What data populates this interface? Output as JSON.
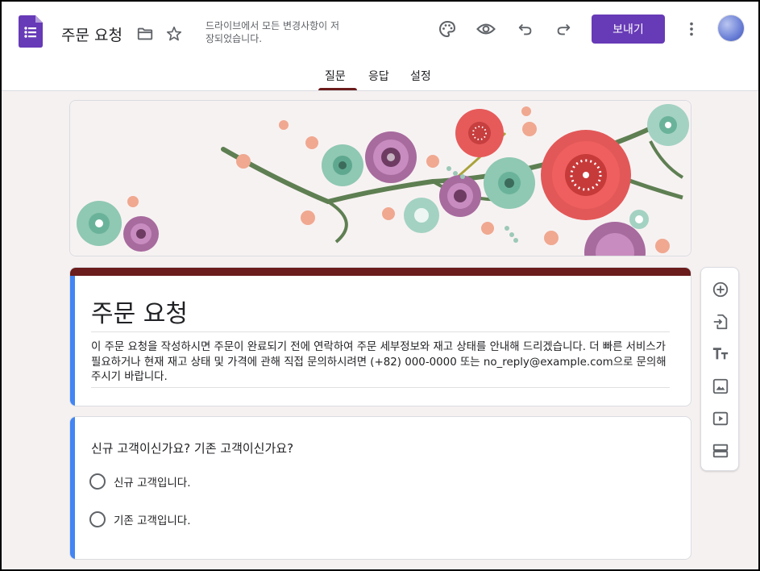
{
  "header": {
    "doc_title": "주문 요청",
    "save_status": "드라이브에서 모든 변경사항이 저장되었습니다.",
    "send_label": "보내기",
    "brand_color": "#673ab7",
    "icons": [
      "forms-logo-icon",
      "folder-icon",
      "star-icon",
      "palette-icon",
      "preview-eye-icon",
      "undo-icon",
      "redo-icon",
      "more-vert-icon"
    ]
  },
  "tabs": [
    {
      "label": "질문",
      "active": true
    },
    {
      "label": "응답",
      "active": false
    },
    {
      "label": "설정",
      "active": false
    }
  ],
  "form": {
    "title": "주문 요청",
    "description": "이 주문 요청을 작성하시면 주문이 완료되기 전에 연락하여 주문 세부정보와 재고 상태를 안내해 드리겠습니다. 더 빠른 서비스가 필요하거나 현재 재고 상태 및 가격에 관해 직접 문의하시려면 (+82) 000-0000 또는 no_reply@example.com으로 문의해 주시기 바랍니다.",
    "theme_color": "#6b1c1c",
    "accent_color": "#4285f4"
  },
  "question": {
    "text": "신규 고객이신가요? 기존 고객이신가요?",
    "options": [
      "신규 고객입니다.",
      "기존 고객입니다."
    ]
  },
  "toolbar": {
    "tools": [
      "add-question-icon",
      "import-questions-icon",
      "add-title-icon",
      "add-image-icon",
      "add-video-icon",
      "add-section-icon"
    ]
  }
}
